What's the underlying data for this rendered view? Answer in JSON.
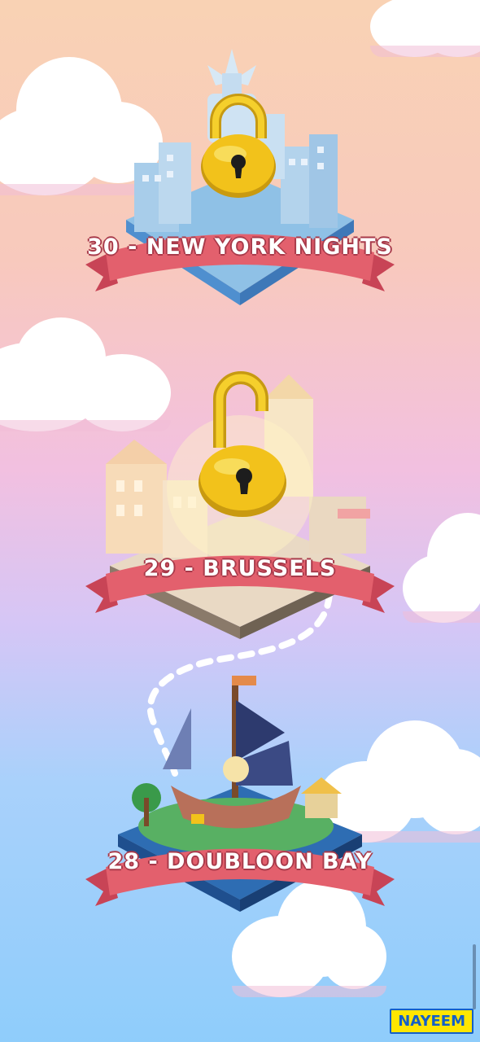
{
  "levels": [
    {
      "number": "30",
      "title": "30 - NEW YORK NIGHTS",
      "state": "locked",
      "icon": "padlock-closed-icon"
    },
    {
      "number": "29",
      "title": "29 - BRUSSELS",
      "state": "unlocking",
      "icon": "padlock-open-icon"
    },
    {
      "number": "28",
      "title": "28 - DOUBLOON BAY",
      "state": "unlocked",
      "icon": "pirate-ship-icon"
    }
  ],
  "watermark": "NAYEEM",
  "colors": {
    "ribbon": "#e3606d",
    "ribbon_dark": "#b43c4d",
    "lock_gold": "#f2c21b",
    "sky_top": "#f9d2b4",
    "sky_bottom": "#8fcdfb"
  }
}
